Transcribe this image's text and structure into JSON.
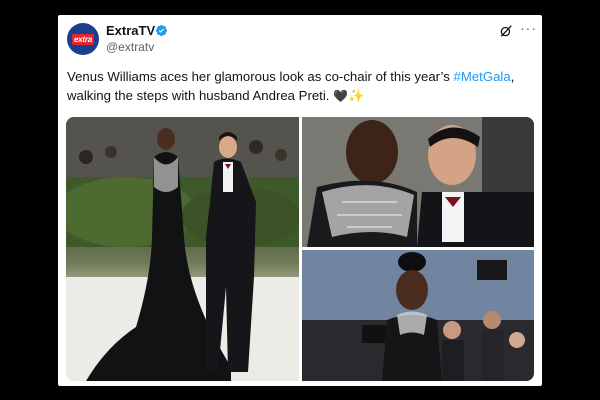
{
  "account": {
    "display_name": "ExtraTV",
    "handle": "@extratv",
    "avatar_text": "extra",
    "verified": true
  },
  "tweet": {
    "text_part1": "Venus Williams aces her glamorous look as co-chair of this year’s",
    "hashtag": "#MetGala",
    "text_part2": ", walking the steps with husband Andrea Preti.",
    "emoji_heart": "🖤",
    "emoji_sparkles": "✨"
  },
  "icons": {
    "verified": "verified-badge-icon",
    "grok": "grok-icon",
    "more": "more-options-icon"
  },
  "colors": {
    "link": "#1d9bf0",
    "verified": "#1d9bf0",
    "text": "#0f1419",
    "secondary_text": "#536471",
    "avatar_bg": "#1b3f8f"
  },
  "more_glyph": "···"
}
